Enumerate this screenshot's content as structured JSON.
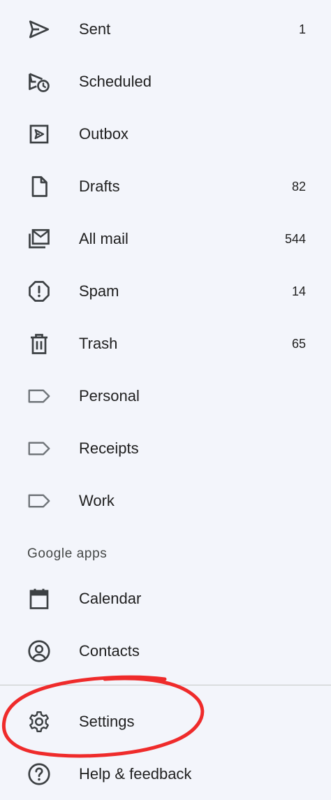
{
  "mail_items": [
    {
      "label": "Sent",
      "count": "1",
      "icon": "send-icon"
    },
    {
      "label": "Scheduled",
      "count": "",
      "icon": "scheduled-icon"
    },
    {
      "label": "Outbox",
      "count": "",
      "icon": "outbox-icon"
    },
    {
      "label": "Drafts",
      "count": "82",
      "icon": "draft-icon"
    },
    {
      "label": "All mail",
      "count": "544",
      "icon": "all-mail-icon"
    },
    {
      "label": "Spam",
      "count": "14",
      "icon": "spam-icon"
    },
    {
      "label": "Trash",
      "count": "65",
      "icon": "trash-icon"
    },
    {
      "label": "Personal",
      "count": "",
      "icon": "label-icon"
    },
    {
      "label": "Receipts",
      "count": "",
      "icon": "label-icon"
    },
    {
      "label": "Work",
      "count": "",
      "icon": "label-icon"
    }
  ],
  "google_apps": {
    "title": "Google apps",
    "items": [
      {
        "label": "Calendar",
        "icon": "calendar-icon"
      },
      {
        "label": "Contacts",
        "icon": "contacts-icon"
      }
    ]
  },
  "footer_items": [
    {
      "label": "Settings",
      "icon": "gear-icon"
    },
    {
      "label": "Help & feedback",
      "icon": "help-icon"
    }
  ],
  "colors": {
    "background": "#f3f5fb",
    "text": "#1f1f1f",
    "icon": "#3c4043",
    "label_tag_outline": "#70757a",
    "annotation": "#ef2b2b"
  }
}
